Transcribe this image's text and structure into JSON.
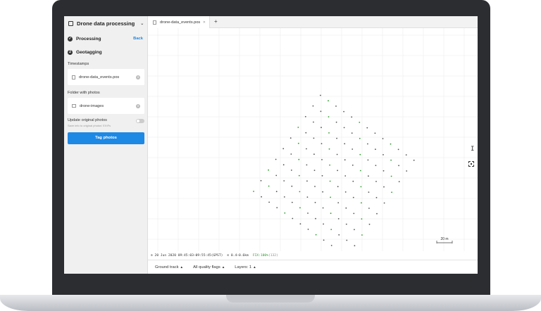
{
  "sidebar": {
    "app_title": "Drone data processing",
    "steps": [
      {
        "label": "Processing",
        "status": "done"
      },
      {
        "label": "Geotagging",
        "status": "active"
      }
    ],
    "back_label": "Back",
    "timestamps_label": "Timestamps",
    "timestamps_file": "drone-data_events.pos",
    "photos_folder_label": "Folder with photos",
    "photos_folder": "drone-images",
    "update_label": "Update original photos",
    "update_hint": "Save info to original photos' EXIFs",
    "update_enabled": false,
    "tag_button": "Tag photos"
  },
  "tabs": [
    {
      "label": "drone-data_events.pos",
      "active": true
    }
  ],
  "map": {
    "scale_label": "20 m",
    "accent": "#2e9b2e"
  },
  "status": {
    "datetime": "20 Jun 2020 09:45:03–09:55:45(GPST)",
    "distance": "0.4–0.6km",
    "fix_prefix": "FIX:",
    "fix_percent": "100%",
    "fix_count": "(132)"
  },
  "bottom_controls": [
    {
      "label": "Ground track"
    },
    {
      "label": "All quality flags"
    },
    {
      "label": "Layers: 1"
    }
  ],
  "colors": {
    "primary_button": "#1e88e5",
    "track_point": "#2e9b2e"
  }
}
